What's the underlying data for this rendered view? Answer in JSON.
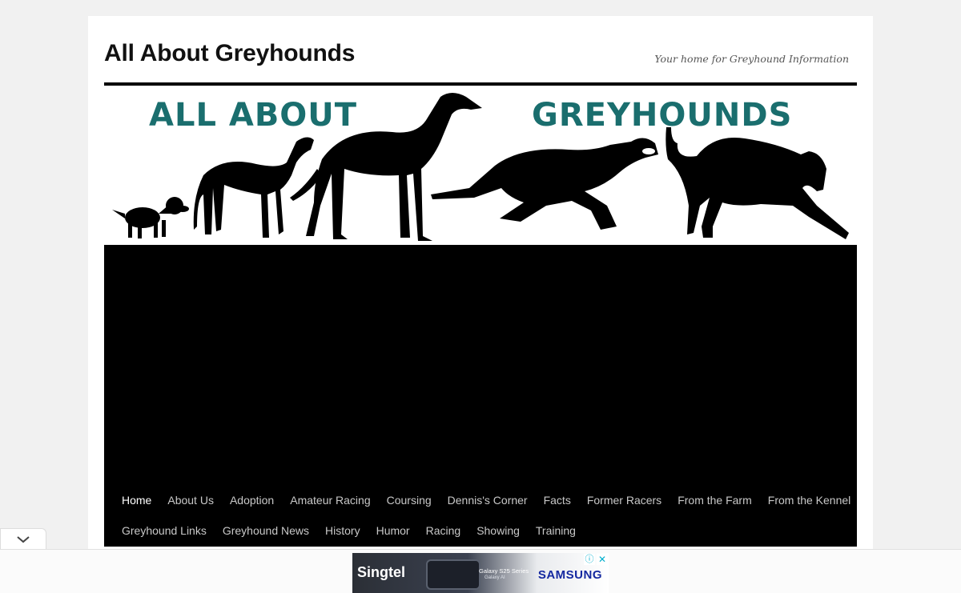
{
  "site": {
    "title": "All About Greyhounds",
    "description": "Your home for Greyhound Information"
  },
  "banner": {
    "left_text": "All About",
    "right_text": "Greyhounds",
    "text_color": "#1a6e6e"
  },
  "menu": {
    "row1": [
      "Home",
      "About Us",
      "Adoption",
      "Amateur Racing",
      "Coursing",
      "Dennis's Corner",
      "Facts",
      "Former Racers",
      "From the Farm",
      "From the Kennel"
    ],
    "row2": [
      "Greyhound Links",
      "Greyhound News",
      "History",
      "Humor",
      "Racing",
      "Showing",
      "Training"
    ],
    "current": "Home"
  },
  "ad": {
    "brand_left": "Singtel",
    "product": "Galaxy S25 Series",
    "product_sub": "Galaxy AI",
    "brand_right": "SAMSUNG",
    "info_icon": "ⓘ",
    "close_icon": "✕"
  },
  "colors": {
    "page_bg": "#f1f1f1",
    "panel_bg": "#000000",
    "menu_text": "#c8c8c8",
    "menu_current": "#ffffff"
  }
}
